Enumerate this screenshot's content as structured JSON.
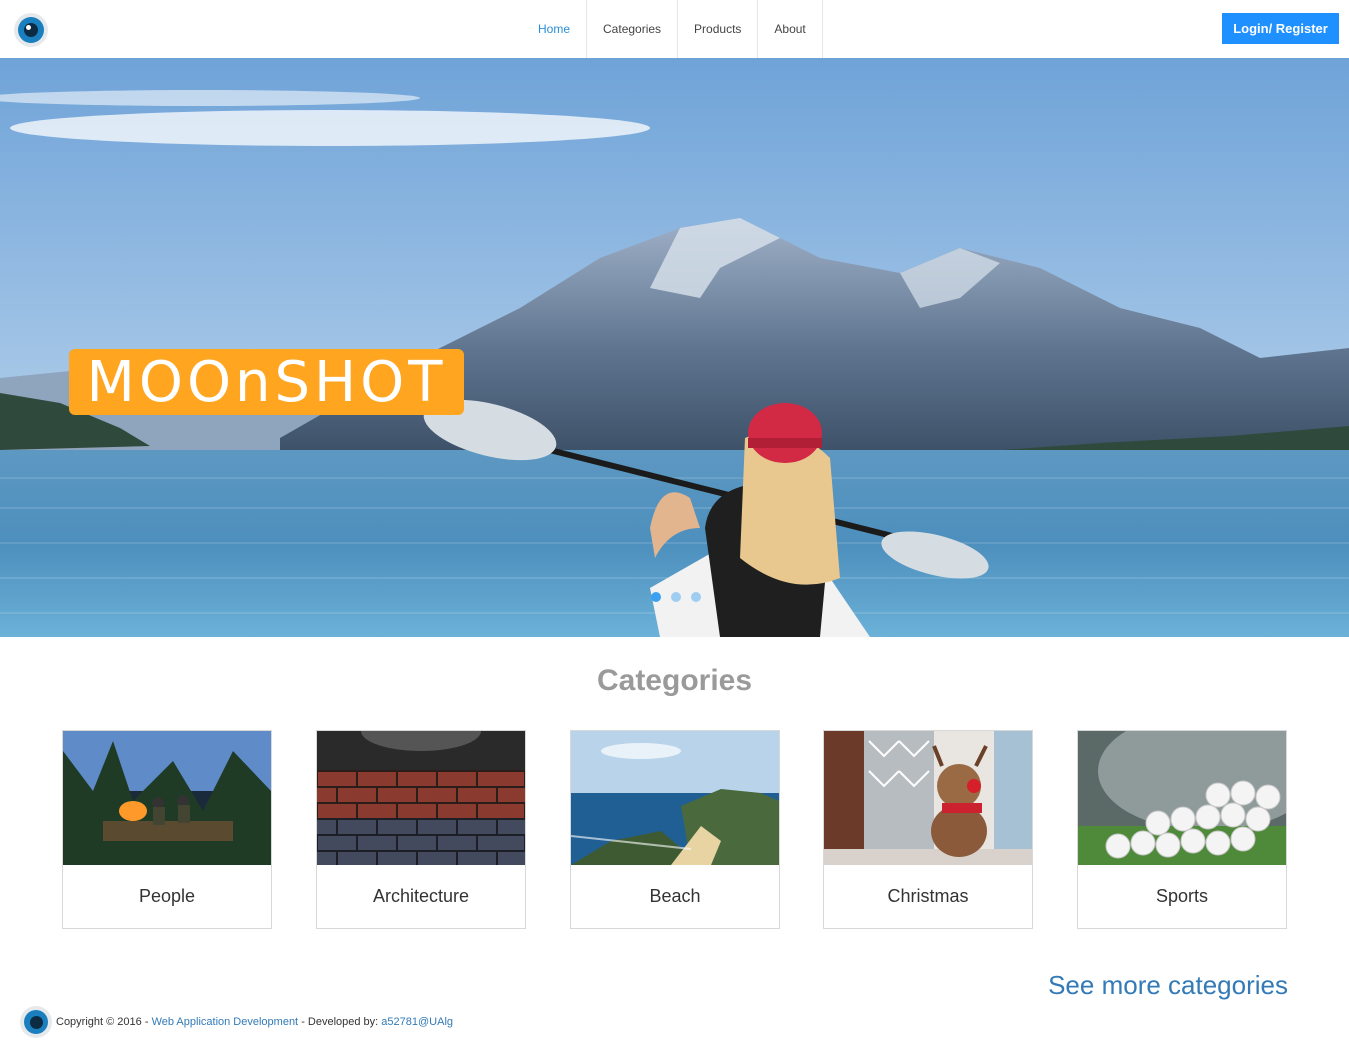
{
  "nav": {
    "logo": "eye-logo",
    "items": [
      {
        "label": "Home",
        "active": true
      },
      {
        "label": "Categories",
        "active": false
      },
      {
        "label": "Products",
        "active": false
      },
      {
        "label": "About",
        "active": false
      }
    ],
    "login_label": "Login/ Register"
  },
  "hero": {
    "brand": "MOOnSHOT",
    "slide_count": 3,
    "active_slide": 1
  },
  "categories": {
    "title": "Categories",
    "items": [
      {
        "label": "People"
      },
      {
        "label": "Architecture"
      },
      {
        "label": "Beach"
      },
      {
        "label": "Christmas"
      },
      {
        "label": "Sports"
      }
    ],
    "see_more": "See more categories"
  },
  "footer": {
    "copyright": "Copyright © 2016 -",
    "course_link": "Web Application Development",
    "developed_by": "- Developed by:",
    "author_link": "a52781@UAlg"
  },
  "colors": {
    "accent": "#1e90ff",
    "brand_badge": "#ffa51f",
    "link": "#337ab7",
    "heading": "#9a9a9a"
  }
}
